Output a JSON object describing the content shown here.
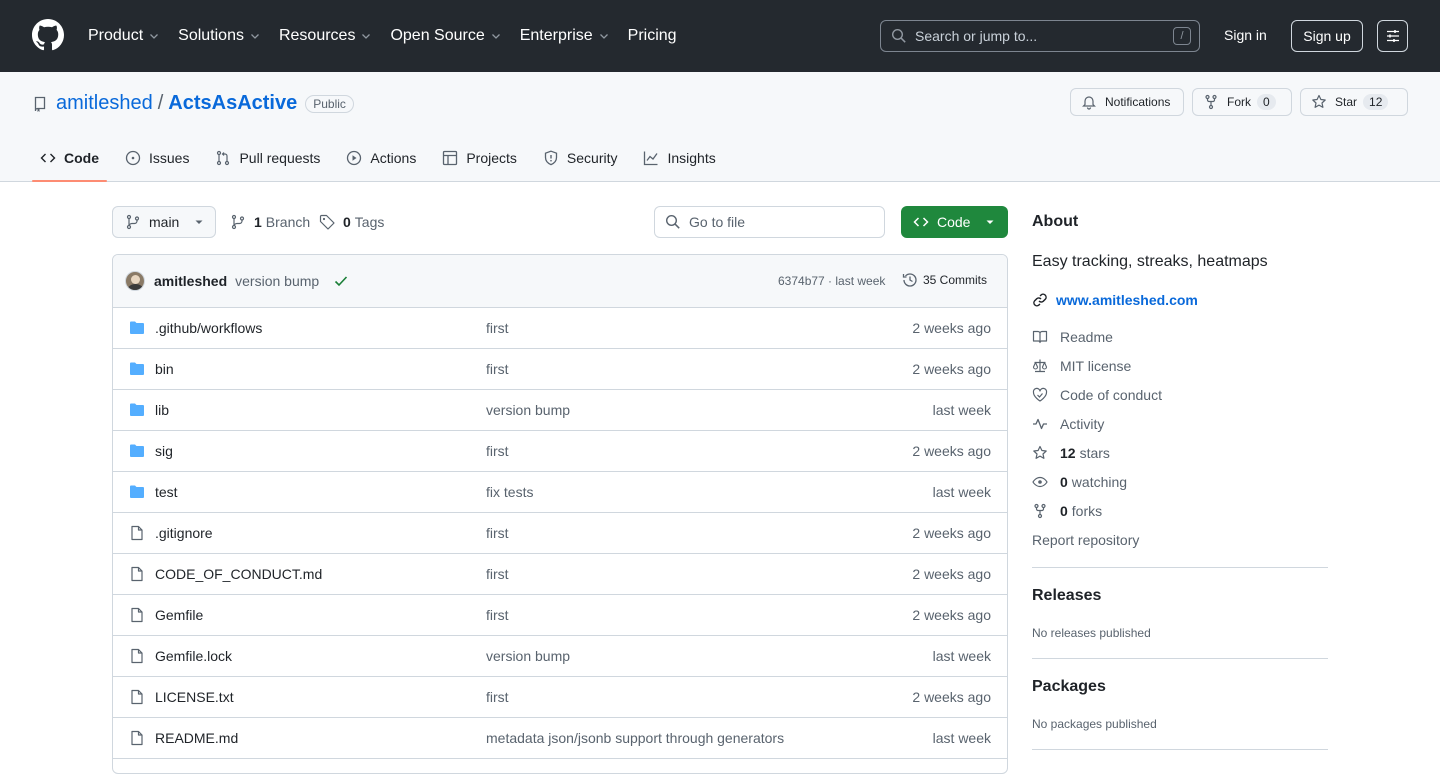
{
  "header": {
    "nav": [
      {
        "label": "Product",
        "has_menu": true
      },
      {
        "label": "Solutions",
        "has_menu": true
      },
      {
        "label": "Resources",
        "has_menu": true
      },
      {
        "label": "Open Source",
        "has_menu": true
      },
      {
        "label": "Enterprise",
        "has_menu": true
      },
      {
        "label": "Pricing",
        "has_menu": false
      }
    ],
    "search_placeholder": "Search or jump to...",
    "search_shortcut": "/",
    "sign_in": "Sign in",
    "sign_up": "Sign up"
  },
  "repo": {
    "owner": "amitleshed",
    "separator": "/",
    "name": "ActsAsActive",
    "visibility": "Public",
    "notifications_label": "Notifications",
    "fork_label": "Fork",
    "fork_count": "0",
    "star_label": "Star",
    "star_count": "12"
  },
  "tabs": [
    {
      "label": "Code",
      "icon": "code-icon",
      "active": true
    },
    {
      "label": "Issues",
      "icon": "issue-icon",
      "active": false
    },
    {
      "label": "Pull requests",
      "icon": "pull-request-icon",
      "active": false
    },
    {
      "label": "Actions",
      "icon": "play-icon",
      "active": false
    },
    {
      "label": "Projects",
      "icon": "table-icon",
      "active": false
    },
    {
      "label": "Security",
      "icon": "shield-icon",
      "active": false
    },
    {
      "label": "Insights",
      "icon": "graph-icon",
      "active": false
    }
  ],
  "toolbar": {
    "branch": "main",
    "branch_count": "1",
    "branch_label": "Branch",
    "tag_count": "0",
    "tag_label": "Tags",
    "goto_placeholder": "Go to file",
    "code_button": "Code"
  },
  "latest_commit": {
    "author": "amitleshed",
    "message": "version bump",
    "sha_age": "6374b77 · last week",
    "commits_label": "35 Commits"
  },
  "files": [
    {
      "name": ".github/workflows",
      "type": "dir",
      "message": "first",
      "date": "2 weeks ago"
    },
    {
      "name": "bin",
      "type": "dir",
      "message": "first",
      "date": "2 weeks ago"
    },
    {
      "name": "lib",
      "type": "dir",
      "message": "version bump",
      "date": "last week"
    },
    {
      "name": "sig",
      "type": "dir",
      "message": "first",
      "date": "2 weeks ago"
    },
    {
      "name": "test",
      "type": "dir",
      "message": "fix tests",
      "date": "last week"
    },
    {
      "name": ".gitignore",
      "type": "file",
      "message": "first",
      "date": "2 weeks ago"
    },
    {
      "name": "CODE_OF_CONDUCT.md",
      "type": "file",
      "message": "first",
      "date": "2 weeks ago"
    },
    {
      "name": "Gemfile",
      "type": "file",
      "message": "first",
      "date": "2 weeks ago"
    },
    {
      "name": "Gemfile.lock",
      "type": "file",
      "message": "version bump",
      "date": "last week"
    },
    {
      "name": "LICENSE.txt",
      "type": "file",
      "message": "first",
      "date": "2 weeks ago"
    },
    {
      "name": "README.md",
      "type": "file",
      "message": "metadata json/jsonb support through generators",
      "date": "last week"
    }
  ],
  "about": {
    "heading": "About",
    "description": "Easy tracking, streaks, heatmaps",
    "website": "www.amitleshed.com",
    "readme": "Readme",
    "license": "MIT license",
    "conduct": "Code of conduct",
    "activity": "Activity",
    "stars_count": "12",
    "stars_label": "stars",
    "watching_count": "0",
    "watching_label": "watching",
    "forks_count": "0",
    "forks_label": "forks",
    "report": "Report repository"
  },
  "releases": {
    "heading": "Releases",
    "sub": "No releases published"
  },
  "packages": {
    "heading": "Packages",
    "sub": "No packages published"
  },
  "colors": {
    "header_bg": "#24292f",
    "accent_link": "#0969da",
    "code_button": "#1f883d",
    "folder": "#54aeff",
    "active_tab_underline": "#fd8c73"
  }
}
